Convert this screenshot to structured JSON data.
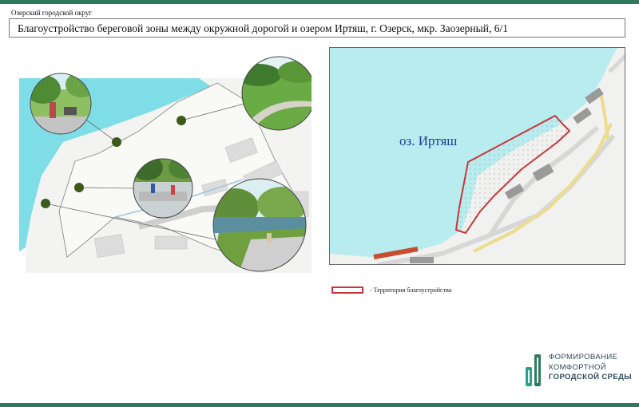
{
  "org": "Озерский городской округ",
  "title": "Благоустройство береговой зоны между окружной дорогой и озером Иртяш, г. Озерск, мкр. Заозерный, 6/1",
  "map": {
    "lake_label": "оз. Иртяш",
    "legend_text": "- Территория благоустройства",
    "boundary_color": "#c8363b",
    "water_color": "#b8ecee"
  },
  "plan": {
    "water_color": "#7fdde8",
    "marker_color": "#3e5a1a",
    "photo_icons": [
      "family-park-photo-icon",
      "green-path-photo-icon",
      "fountain-plaza-photo-icon",
      "waterfront-seating-photo-icon"
    ]
  },
  "brand": {
    "line1": "ФОРМИРОВАНИЕ",
    "line2": "КОМФОРТНОЙ",
    "line3": "ГОРОДСКОЙ СРЕДЫ",
    "accent": "#1fa58a"
  }
}
